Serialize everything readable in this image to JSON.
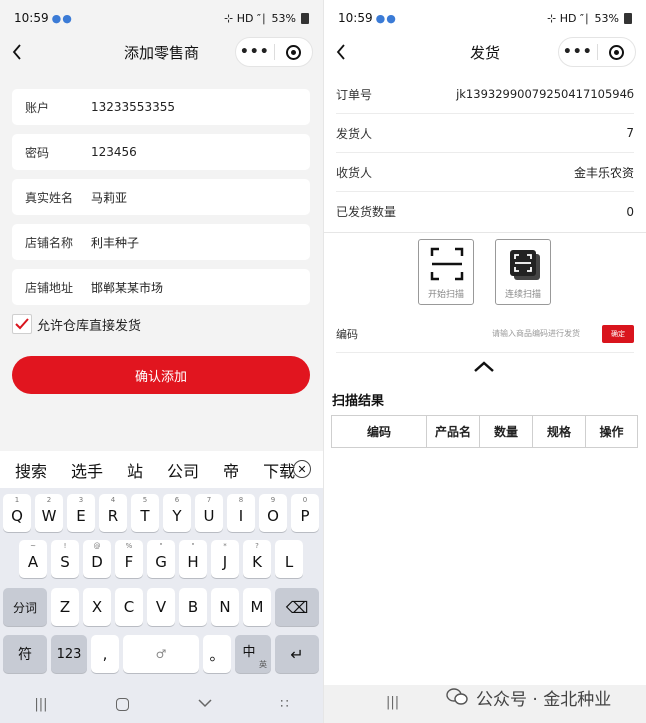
{
  "left": {
    "status": {
      "time": "10:59",
      "icons": "●●",
      "signal": "⊹ HD ″∣",
      "battery": "53%"
    },
    "nav": {
      "title": "添加零售商",
      "more": "•••"
    },
    "form": {
      "fields": [
        {
          "label": "账户",
          "value": "13233553355"
        },
        {
          "label": "密码",
          "value": "123456"
        },
        {
          "label": "真实姓名",
          "value": "马莉亚"
        },
        {
          "label": "店铺名称",
          "value": "利丰种子"
        },
        {
          "label": "店铺地址",
          "value": "邯郸某某市场"
        }
      ],
      "allow_label": "允许仓库直接发货",
      "allow_checked": true,
      "confirm_label": "确认添加"
    },
    "keyboard": {
      "suggestions": [
        "搜索",
        "选手",
        "站",
        "公司",
        "帝",
        "下载"
      ],
      "close_glyph": "✕",
      "row1": [
        {
          "k": "Q",
          "h": "1"
        },
        {
          "k": "W",
          "h": "2"
        },
        {
          "k": "E",
          "h": "3"
        },
        {
          "k": "R",
          "h": "4"
        },
        {
          "k": "T",
          "h": "5"
        },
        {
          "k": "Y",
          "h": "6"
        },
        {
          "k": "U",
          "h": "7"
        },
        {
          "k": "I",
          "h": "8"
        },
        {
          "k": "O",
          "h": "9"
        },
        {
          "k": "P",
          "h": "0"
        }
      ],
      "row2": [
        {
          "k": "A",
          "h": "~"
        },
        {
          "k": "S",
          "h": "!"
        },
        {
          "k": "D",
          "h": "@"
        },
        {
          "k": "F",
          "h": "%"
        },
        {
          "k": "G",
          "h": "\""
        },
        {
          "k": "H",
          "h": "\""
        },
        {
          "k": "J",
          "h": "*"
        },
        {
          "k": "K",
          "h": "?"
        },
        {
          "k": "L",
          "h": ""
        }
      ],
      "row3": [
        "Z",
        "X",
        "C",
        "V",
        "B",
        "N",
        "M"
      ],
      "fenci": "分词",
      "backspace": "⌫",
      "fu": "符",
      "num": "123",
      "comma": ",",
      "space_mic": "♂",
      "period": "。",
      "zh": "中",
      "zh_sub": "英",
      "enter": "↵",
      "nav_menu": "|||",
      "nav_keyboard": "∷"
    }
  },
  "right": {
    "status": {
      "time": "10:59",
      "icons": "●●",
      "signal": "⊹ HD ″∣",
      "battery": "53%"
    },
    "nav": {
      "title": "发货",
      "more": "•••"
    },
    "info": [
      {
        "label": "订单号",
        "value": "jk1393299007925041710594б"
      },
      {
        "label": "发货人",
        "value": "7"
      },
      {
        "label": "收货人",
        "value": "金丰乐农资"
      },
      {
        "label": "已发货数量",
        "value": "0"
      }
    ],
    "scan": {
      "start": "开始扫描",
      "continuous": "连续扫描"
    },
    "code": {
      "label": "编码",
      "placeholder": "请输入商品编码进行发货",
      "confirm": "确定"
    },
    "results": {
      "title": "扫描结果",
      "headers": [
        "编码",
        "产品名",
        "数量",
        "规格",
        "操作"
      ]
    },
    "nav_menu": "|||",
    "watermark": "公众号 · 金北种业"
  }
}
